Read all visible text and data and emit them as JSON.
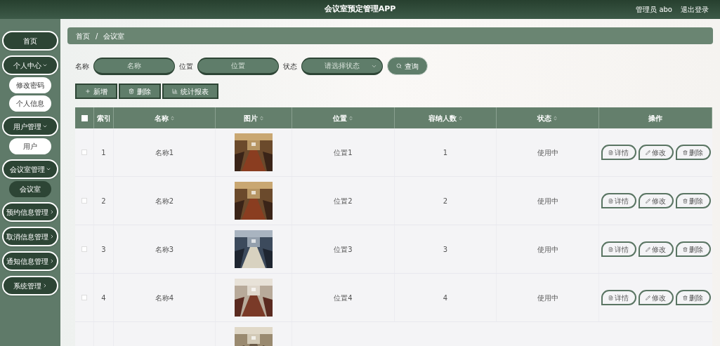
{
  "header": {
    "title": "会议室预定管理APP",
    "user": "管理员 abo",
    "logout": "退出登录"
  },
  "sidebar": {
    "items": [
      {
        "label": "首页"
      },
      {
        "label": "个人中心",
        "expanded": true,
        "children": [
          {
            "label": "修改密码",
            "selected": false
          },
          {
            "label": "个人信息",
            "selected": false
          }
        ]
      },
      {
        "label": "用户管理",
        "expanded": true,
        "children": [
          {
            "label": "用户",
            "selected": false
          }
        ]
      },
      {
        "label": "会议室管理",
        "expanded": true,
        "children": [
          {
            "label": "会议室",
            "selected": true
          }
        ]
      },
      {
        "label": "预约信息管理",
        "expanded": false
      },
      {
        "label": "取消信息管理",
        "expanded": false
      },
      {
        "label": "通知信息管理",
        "expanded": false
      },
      {
        "label": "系统管理",
        "expanded": false
      }
    ]
  },
  "breadcrumb": [
    "首页",
    "/",
    "会议室"
  ],
  "search": {
    "fields": [
      {
        "label": "名称",
        "placeholder": "名称",
        "kind": "text"
      },
      {
        "label": "位置",
        "placeholder": "位置",
        "kind": "text"
      },
      {
        "label": "状态",
        "placeholder": "请选择状态",
        "kind": "select"
      }
    ],
    "button": "查询"
  },
  "actions": [
    {
      "label": "新增",
      "kind": "add"
    },
    {
      "label": "删除",
      "kind": "delete"
    },
    {
      "label": "统计报表",
      "kind": "chart"
    }
  ],
  "table": {
    "select_all_checked": false,
    "columns": [
      {
        "label": "索引",
        "sortable": false
      },
      {
        "label": "名称",
        "sortable": true
      },
      {
        "label": "图片",
        "sortable": true
      },
      {
        "label": "位置",
        "sortable": true
      },
      {
        "label": "容纳人数",
        "sortable": true
      },
      {
        "label": "状态",
        "sortable": true
      },
      {
        "label": "操作",
        "sortable": false
      }
    ],
    "rows": [
      {
        "index": "1",
        "name": "名称1",
        "location": "位置1",
        "capacity": "1",
        "status": "使用中",
        "checked": false,
        "actions": [
          {
            "label": "详情",
            "kind": "detail"
          },
          {
            "label": "修改",
            "kind": "edit"
          },
          {
            "label": "删除",
            "kind": "delete"
          }
        ]
      },
      {
        "index": "2",
        "name": "名称2",
        "location": "位置2",
        "capacity": "2",
        "status": "使用中",
        "checked": false,
        "actions": [
          {
            "label": "详情",
            "kind": "detail"
          },
          {
            "label": "修改",
            "kind": "edit"
          },
          {
            "label": "删除",
            "kind": "delete"
          }
        ]
      },
      {
        "index": "3",
        "name": "名称3",
        "location": "位置3",
        "capacity": "3",
        "status": "使用中",
        "checked": false,
        "actions": [
          {
            "label": "详情",
            "kind": "detail"
          },
          {
            "label": "修改",
            "kind": "edit"
          },
          {
            "label": "删除",
            "kind": "delete"
          }
        ]
      },
      {
        "index": "4",
        "name": "名称4",
        "location": "位置4",
        "capacity": "4",
        "status": "使用中",
        "checked": false,
        "actions": [
          {
            "label": "详情",
            "kind": "detail"
          },
          {
            "label": "修改",
            "kind": "edit"
          },
          {
            "label": "删除",
            "kind": "delete"
          }
        ]
      }
    ]
  }
}
